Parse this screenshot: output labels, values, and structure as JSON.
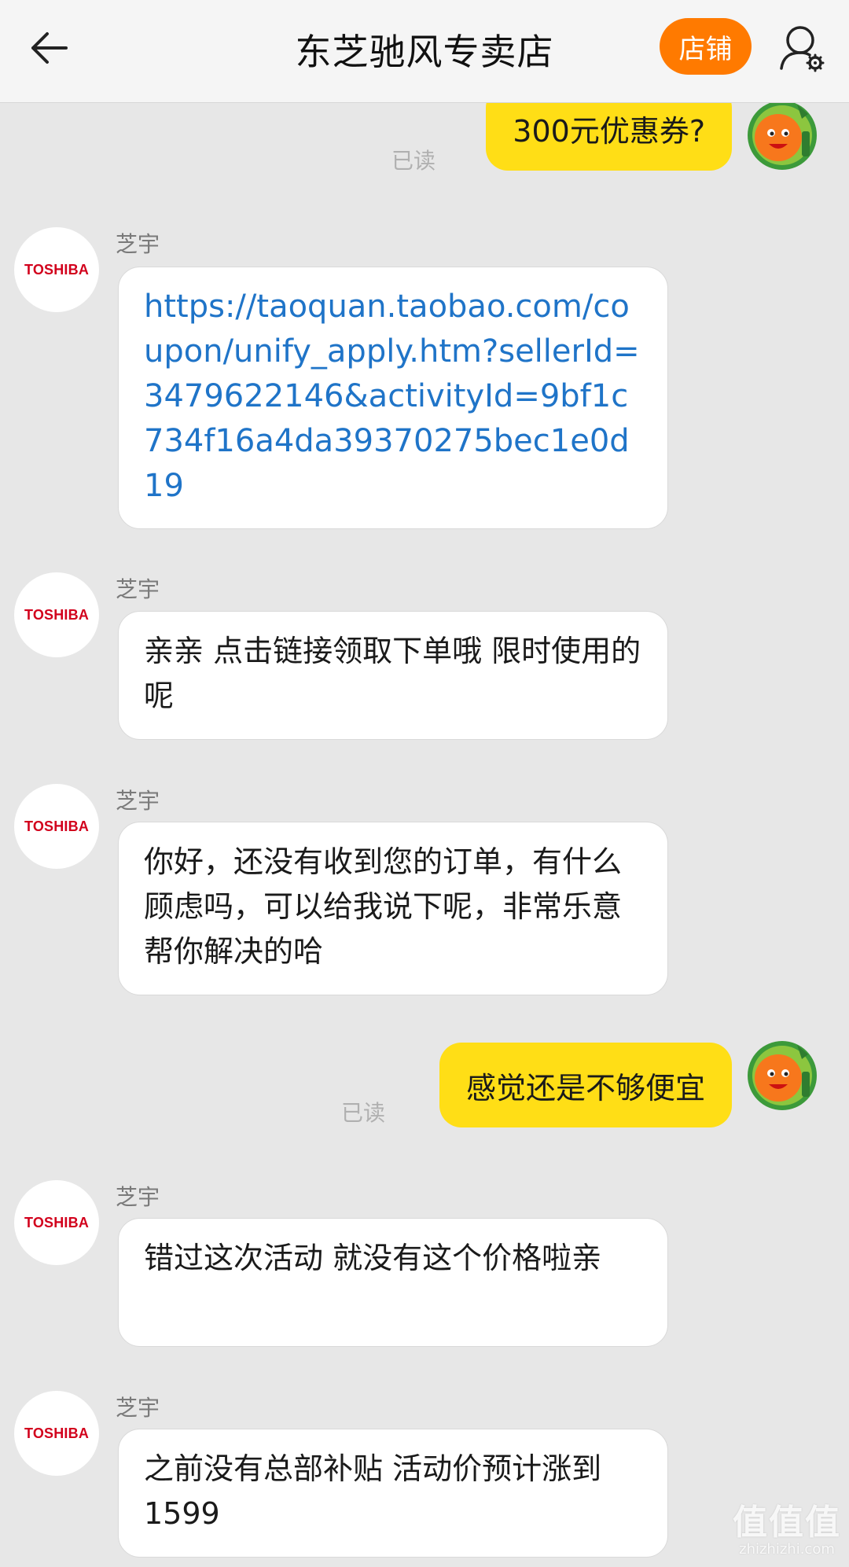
{
  "header": {
    "title": "东芝驰风专卖店",
    "shop_button": "店铺",
    "back_icon": "arrow-left-icon",
    "user_settings_icon": "user-gear-icon"
  },
  "colors": {
    "accent": "#ff7a00",
    "my_bubble": "#ffde16",
    "link": "#1f74c8",
    "brand": "#d2001c"
  },
  "messages": [
    {
      "side": "right",
      "text": "300元优惠券?",
      "status": "已读"
    },
    {
      "side": "left",
      "sender": "芝宇",
      "avatar_text": "TOSHIBA",
      "text": "https://taoquan.taobao.com/coupon/unify_apply.htm?sellerId=3479622146&activityId=9bf1c734f16a4da39370275bec1e0d19"
    },
    {
      "side": "left",
      "sender": "芝宇",
      "avatar_text": "TOSHIBA",
      "text": "亲亲 点击链接领取下单哦 限时使用的呢"
    },
    {
      "side": "left",
      "sender": "芝宇",
      "avatar_text": "TOSHIBA",
      "text": "你好，还没有收到您的订单，有什么顾虑吗，可以给我说下呢，非常乐意帮你解决的哈"
    },
    {
      "side": "right",
      "text": "感觉还是不够便宜",
      "status": "已读"
    },
    {
      "side": "left",
      "sender": "芝宇",
      "avatar_text": "TOSHIBA",
      "text": "错过这次活动 就没有这个价格啦亲"
    },
    {
      "side": "left",
      "sender": "芝宇",
      "avatar_text": "TOSHIBA",
      "text": "之前没有总部补贴 活动价预计涨到1599"
    }
  ],
  "watermark": {
    "main": "值值值",
    "sub": "zhizhizhi.com"
  }
}
